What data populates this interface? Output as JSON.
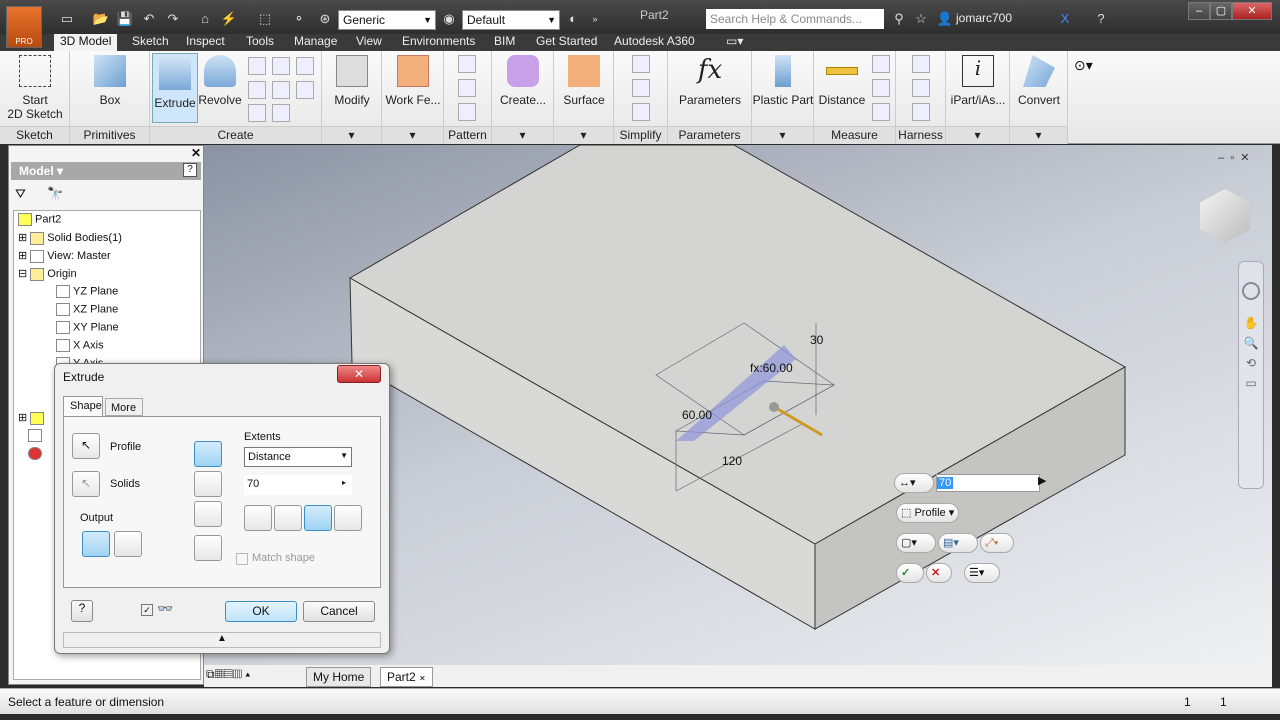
{
  "app": {
    "badge": "PRO",
    "document_title": "Part2",
    "search_placeholder": "Search Help & Commands...",
    "user": "jomarc700",
    "material": "Generic",
    "appearance": "Default"
  },
  "tabs": [
    "3D Model",
    "Sketch",
    "Inspect",
    "Tools",
    "Manage",
    "View",
    "Environments",
    "BIM",
    "Get Started",
    "Autodesk A360"
  ],
  "ribbon": {
    "panels": [
      {
        "label": "Sketch",
        "buttons": [
          "Start\n2D Sketch"
        ]
      },
      {
        "label": "Primitives",
        "buttons": [
          "Box"
        ]
      },
      {
        "label": "Create",
        "buttons": [
          "Extrude",
          "Revolve"
        ]
      },
      {
        "label": "",
        "buttons": [
          "Modify"
        ]
      },
      {
        "label": "",
        "buttons": [
          "Work Fe..."
        ]
      },
      {
        "label": "Pattern",
        "buttons": []
      },
      {
        "label": "",
        "buttons": [
          "Create..."
        ]
      },
      {
        "label": "",
        "buttons": [
          "Surface"
        ]
      },
      {
        "label": "Simplify",
        "buttons": []
      },
      {
        "label": "Parameters",
        "buttons": [
          "Parameters"
        ]
      },
      {
        "label": "",
        "buttons": [
          "Plastic Part"
        ]
      },
      {
        "label": "Measure",
        "buttons": [
          "Distance"
        ]
      },
      {
        "label": "Harness",
        "buttons": []
      },
      {
        "label": "",
        "buttons": [
          "iPart/iAs..."
        ]
      },
      {
        "label": "",
        "buttons": [
          "Convert"
        ]
      }
    ]
  },
  "browser": {
    "title": "Model",
    "items": [
      "Part2",
      "Solid Bodies(1)",
      "View: Master",
      "Origin",
      "YZ Plane",
      "XZ Plane",
      "XY Plane",
      "X Axis",
      "Y Axis"
    ]
  },
  "dialog": {
    "title": "Extrude",
    "tabs": [
      "Shape",
      "More"
    ],
    "profile": "Profile",
    "solids": "Solids",
    "output": "Output",
    "extents": "Extents",
    "extents_type": "Distance",
    "distance": "70",
    "match_shape": "Match shape",
    "ok": "OK",
    "cancel": "Cancel"
  },
  "viewport": {
    "dims": [
      "30",
      "fx:60.00",
      "60.00",
      "120"
    ],
    "mini_value": "70",
    "mini_profile": "Profile"
  },
  "doc_tabs": [
    "My Home",
    "Part2"
  ],
  "status": {
    "text": "Select a feature or dimension",
    "count1": "1",
    "count2": "1"
  }
}
